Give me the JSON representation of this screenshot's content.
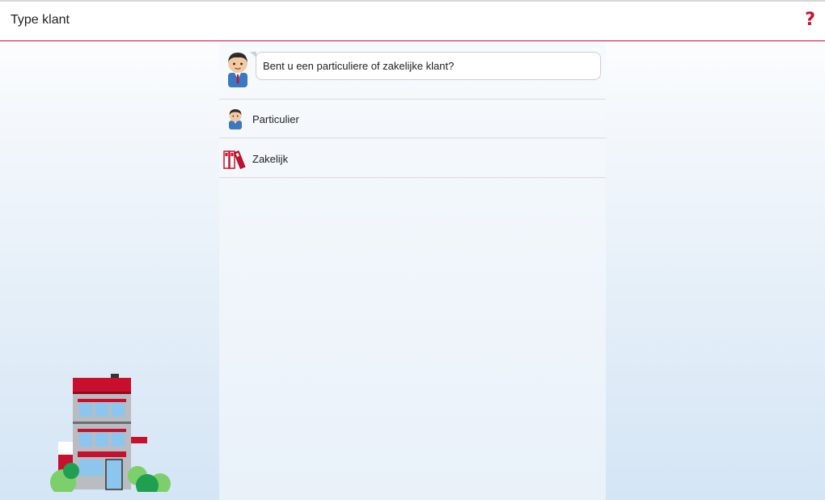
{
  "header": {
    "title": "Type klant",
    "help_icon": "help-question-icon",
    "accent": "#c8102e"
  },
  "prompt": {
    "avatar_icon": "advisor-avatar-icon",
    "question": "Bent u een particuliere of zakelijke klant?"
  },
  "options": [
    {
      "label": "Particulier",
      "icon": "person-avatar-icon"
    },
    {
      "label": "Zakelijk",
      "icon": "binders-icon"
    }
  ],
  "illustration": {
    "icon": "bank-building-icon"
  }
}
